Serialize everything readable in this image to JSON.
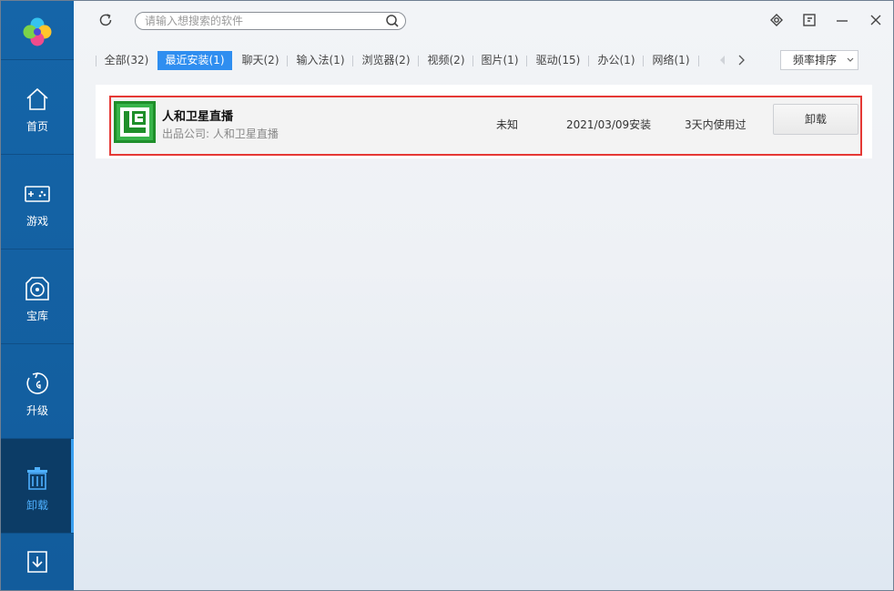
{
  "sidebar": {
    "items": [
      {
        "label": "首页",
        "icon": "home-icon"
      },
      {
        "label": "游戏",
        "icon": "gamepad-icon"
      },
      {
        "label": "宝库",
        "icon": "disc-icon"
      },
      {
        "label": "升级",
        "icon": "upgrade-icon"
      },
      {
        "label": "卸载",
        "icon": "trash-icon"
      },
      {
        "label": "",
        "icon": "download-icon"
      }
    ],
    "active_color": "#4eb0ff"
  },
  "search": {
    "placeholder": "请输入想搜索的软件"
  },
  "tabs": [
    {
      "label": "全部(32)"
    },
    {
      "label": "最近安装(1)"
    },
    {
      "label": "聊天(2)"
    },
    {
      "label": "输入法(1)"
    },
    {
      "label": "浏览器(2)"
    },
    {
      "label": "视频(2)"
    },
    {
      "label": "图片(1)"
    },
    {
      "label": "驱动(15)"
    },
    {
      "label": "办公(1)"
    },
    {
      "label": "网络(1)"
    }
  ],
  "sort": {
    "label": "频率排序"
  },
  "software": [
    {
      "name": "人和卫星直播",
      "company": "出品公司: 人和卫星直播",
      "size": "未知",
      "install_date": "2021/03/09安装",
      "usage": "3天内使用过",
      "action": "卸载"
    }
  ],
  "colors": {
    "sidebar": "#1565a8",
    "tab_active": "#2f8ef0",
    "highlight_border": "#e53935"
  }
}
